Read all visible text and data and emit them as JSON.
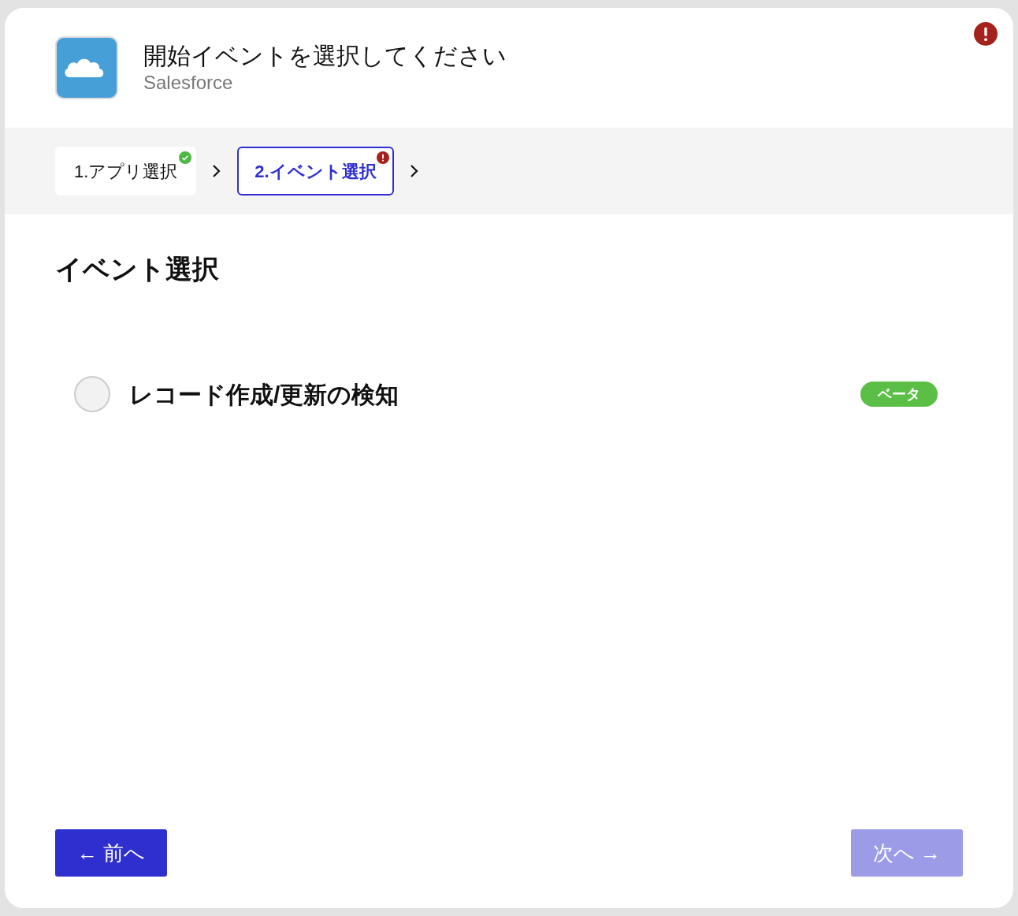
{
  "header": {
    "title": "開始イベントを選択してください",
    "app_name": "Salesforce",
    "has_error": true
  },
  "steps": [
    {
      "label": "1.アプリ選択",
      "selected": false,
      "kind": "done"
    },
    {
      "label": "2.イベント選択",
      "selected": true,
      "kind": "error"
    }
  ],
  "section_title": "イベント選択",
  "events": [
    {
      "label": "レコード作成/更新の検知",
      "selected": false,
      "badge": "ベータ"
    }
  ],
  "buttons": {
    "back": {
      "label": "← 前へ",
      "disabled": false
    },
    "next": {
      "label": "次へ →",
      "disabled": true
    }
  }
}
